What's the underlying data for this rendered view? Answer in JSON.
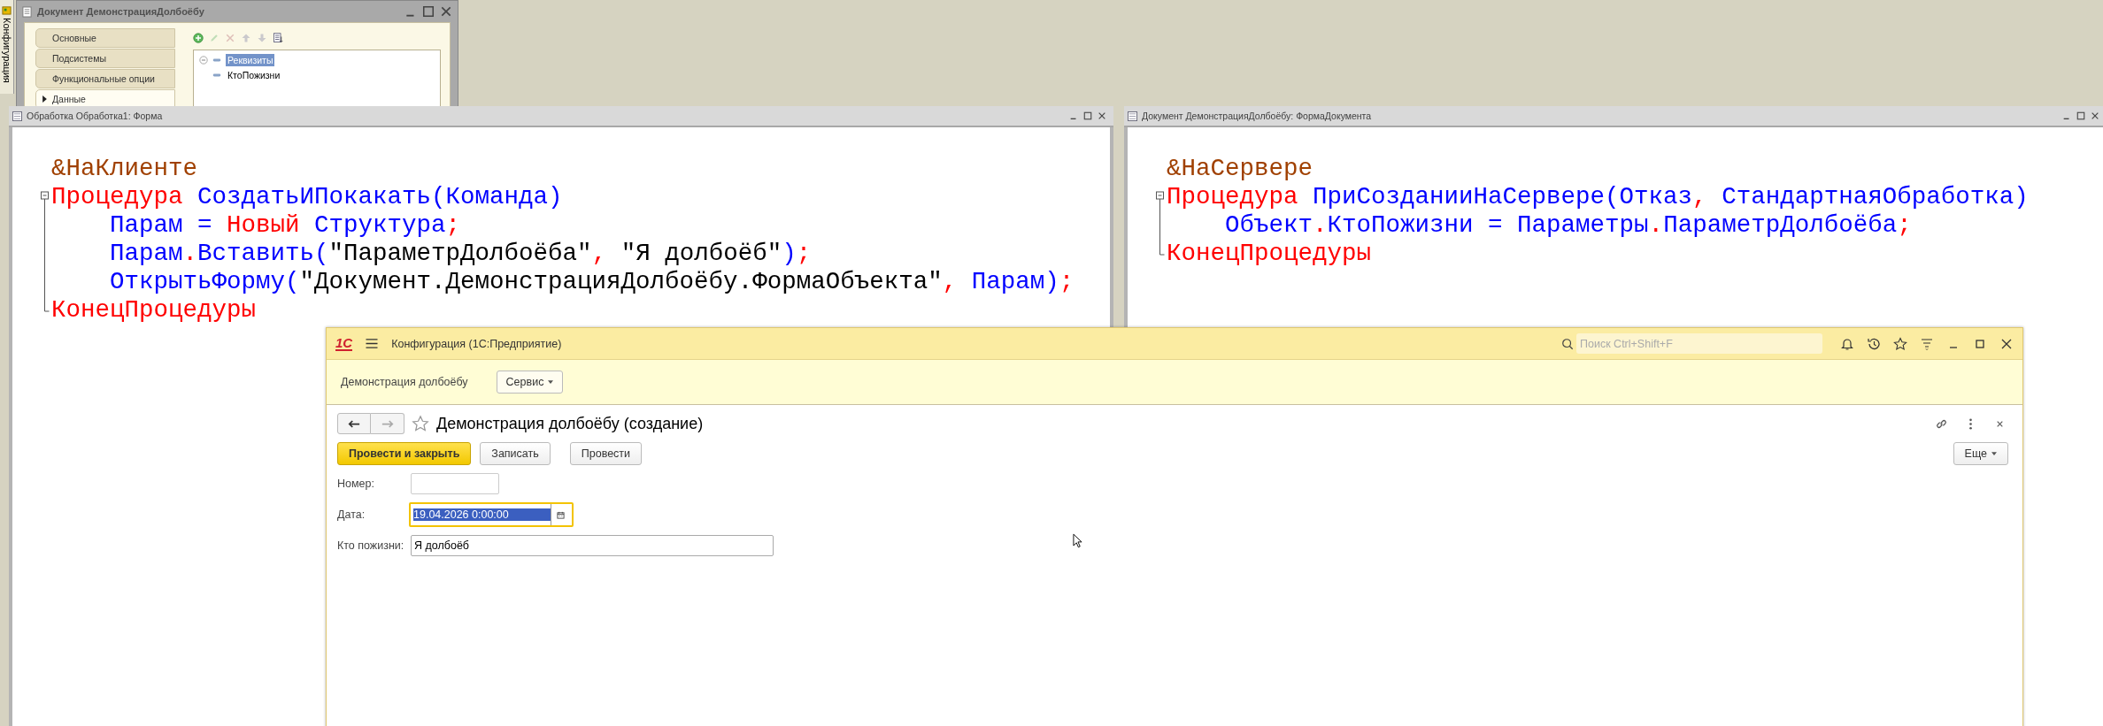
{
  "side_panel": {
    "label": "Конфигурация"
  },
  "object_window": {
    "title": "Документ ДемонстрацияДолбоёбу",
    "tabs": [
      {
        "label": "Основные",
        "selected": false
      },
      {
        "label": "Подсистемы",
        "selected": false
      },
      {
        "label": "Функциональные опции",
        "selected": false
      },
      {
        "label": "Данные",
        "selected": true
      }
    ],
    "toolbar": [
      {
        "kind": "add",
        "disabled": false
      },
      {
        "kind": "edit",
        "disabled": true
      },
      {
        "kind": "delete",
        "disabled": true
      },
      {
        "kind": "up",
        "disabled": true
      },
      {
        "kind": "down",
        "disabled": true
      },
      {
        "kind": "list",
        "disabled": false
      }
    ],
    "tree": [
      {
        "label": "Реквизиты",
        "selected": true,
        "expanded": true,
        "children": [
          {
            "label": "КтоПожизни",
            "selected": false
          }
        ]
      }
    ]
  },
  "code_windows": [
    {
      "title": "Обработка Обработка1: Форма",
      "lines": [
        {
          "kind": "plain",
          "tokens": [
            {
              "t": "&НаКлиенте",
              "kind": "directive"
            }
          ]
        },
        {
          "kind": "fold-start",
          "tokens": [
            {
              "t": "Процедура ",
              "kind": "keyword"
            },
            {
              "t": "СоздатьИПокакать(Команда)",
              "kind": "identifier"
            }
          ]
        },
        {
          "kind": "fold-body",
          "tokens": [
            {
              "t": "    Парам = ",
              "kind": "identifier"
            },
            {
              "t": "Новый ",
              "kind": "keyword"
            },
            {
              "t": "Структура",
              "kind": "identifier"
            },
            {
              "t": ";",
              "kind": "operator"
            }
          ]
        },
        {
          "kind": "fold-body",
          "tokens": [
            {
              "t": "    Парам",
              "kind": "identifier"
            },
            {
              "t": ".",
              "kind": "operator"
            },
            {
              "t": "Вставить(",
              "kind": "identifier"
            },
            {
              "t": "\"ПараметрДолбоёба\"",
              "kind": "string"
            },
            {
              "t": ", ",
              "kind": "operator"
            },
            {
              "t": "\"Я долбоёб\"",
              "kind": "string"
            },
            {
              "t": ")",
              "kind": "identifier"
            },
            {
              "t": ";",
              "kind": "operator"
            }
          ]
        },
        {
          "kind": "fold-body",
          "tokens": [
            {
              "t": "    ОткрытьФорму(",
              "kind": "identifier"
            },
            {
              "t": "\"Документ.ДемонстрацияДолбоёбу.ФормаОбъекта\"",
              "kind": "string"
            },
            {
              "t": ", ",
              "kind": "operator"
            },
            {
              "t": "Парам)",
              "kind": "identifier"
            },
            {
              "t": ";",
              "kind": "operator"
            }
          ]
        },
        {
          "kind": "fold-end",
          "tokens": [
            {
              "t": "КонецПроцедуры",
              "kind": "keyword"
            }
          ]
        }
      ]
    },
    {
      "title": "Документ ДемонстрацияДолбоёбу: ФормаДокумента",
      "lines": [
        {
          "kind": "plain",
          "tokens": [
            {
              "t": "&НаСервере",
              "kind": "directive"
            }
          ]
        },
        {
          "kind": "fold-start",
          "tokens": [
            {
              "t": "Процедура ",
              "kind": "keyword"
            },
            {
              "t": "ПриСозданииНаСервере(Отказ",
              "kind": "identifier"
            },
            {
              "t": ", ",
              "kind": "operator"
            },
            {
              "t": "СтандартнаяОбработка)",
              "kind": "identifier"
            }
          ]
        },
        {
          "kind": "fold-body",
          "tokens": [
            {
              "t": "    Объект",
              "kind": "identifier"
            },
            {
              "t": ".",
              "kind": "operator"
            },
            {
              "t": "КтоПожизни = Параметры",
              "kind": "identifier"
            },
            {
              "t": ".",
              "kind": "operator"
            },
            {
              "t": "ПараметрДолбоёба",
              "kind": "identifier"
            },
            {
              "t": ";",
              "kind": "operator"
            }
          ]
        },
        {
          "kind": "fold-end",
          "tokens": [
            {
              "t": "КонецПроцедуры",
              "kind": "keyword"
            }
          ]
        }
      ]
    }
  ],
  "app": {
    "logo": "1С",
    "title": "Конфигурация  (1С:Предприятие)",
    "search": {
      "placeholder": "Поиск Ctrl+Shift+F"
    },
    "section": {
      "title": "Демонстрация долбоёбу",
      "menu_button": "Сервис"
    },
    "form": {
      "title": "Демонстрация долбоёбу (создание)",
      "buttons": [
        {
          "label": "Провести и закрыть",
          "default": true
        },
        {
          "label": "Записать",
          "default": false
        },
        {
          "label": "Провести",
          "default": false
        }
      ],
      "more_button": "Еще",
      "fields": [
        {
          "kind": "text",
          "label": "Номер:",
          "focused": false
        },
        {
          "kind": "date",
          "label": "Дата:",
          "value": "19.04.2026  0:00:00",
          "focused": true,
          "selected": true
        },
        {
          "kind": "text",
          "label": "Кто пожизни:",
          "value": "Я долбоёб",
          "focused": false
        }
      ]
    }
  }
}
